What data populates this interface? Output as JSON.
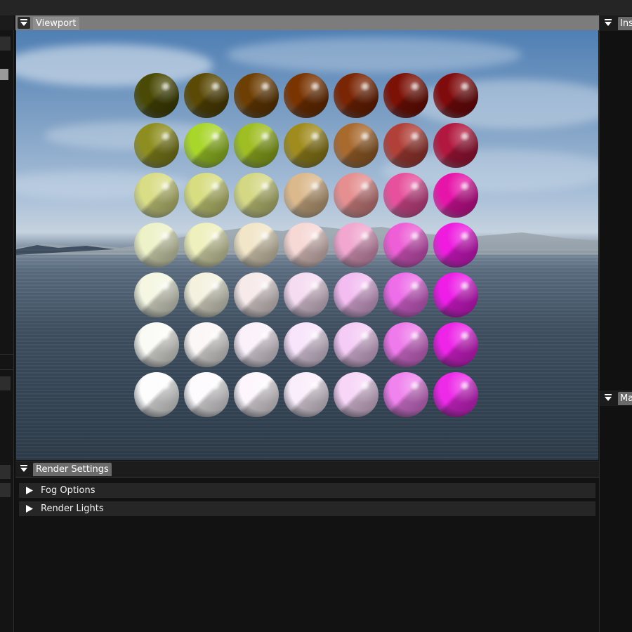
{
  "viewport": {
    "title": "Viewport"
  },
  "render_settings": {
    "title": "Render Settings",
    "sections": [
      {
        "label": "Fog Options"
      },
      {
        "label": "Render Lights"
      }
    ]
  },
  "right_panels": [
    {
      "title": "Ins"
    },
    {
      "title": "Ma"
    }
  ],
  "spheres": {
    "rows": 7,
    "cols": 7,
    "colors": [
      [
        "#4a4a06",
        "#5b4a06",
        "#6e3f04",
        "#7a3402",
        "#7a2503",
        "#7c1106",
        "#800b0d"
      ],
      [
        "#8e8e20",
        "#a9d62a",
        "#9fbe23",
        "#a08c1e",
        "#a96a2e",
        "#b04038",
        "#b2183f"
      ],
      [
        "#d9dd86",
        "#d7dd80",
        "#d4d884",
        "#dbb98c",
        "#e58f90",
        "#e7509c",
        "#e714a9"
      ],
      [
        "#eef2c8",
        "#eef0bd",
        "#f2e6c9",
        "#f6d8d5",
        "#f1a7cf",
        "#ee5ed6",
        "#ef1ce0"
      ],
      [
        "#f5f7e3",
        "#f4f2df",
        "#f7eaea",
        "#f6dcf1",
        "#f3bdf1",
        "#ee6ee9",
        "#ee1ee8"
      ],
      [
        "#fbfbf6",
        "#fbf7f6",
        "#fbf1fb",
        "#f8e4fb",
        "#f5ccf6",
        "#ef7aeb",
        "#ee24e8"
      ],
      [
        "#fdfdfd",
        "#fdfbfd",
        "#fdf7fd",
        "#fbeefc",
        "#f7d6f7",
        "#f083ee",
        "#ee2ae9"
      ]
    ]
  }
}
